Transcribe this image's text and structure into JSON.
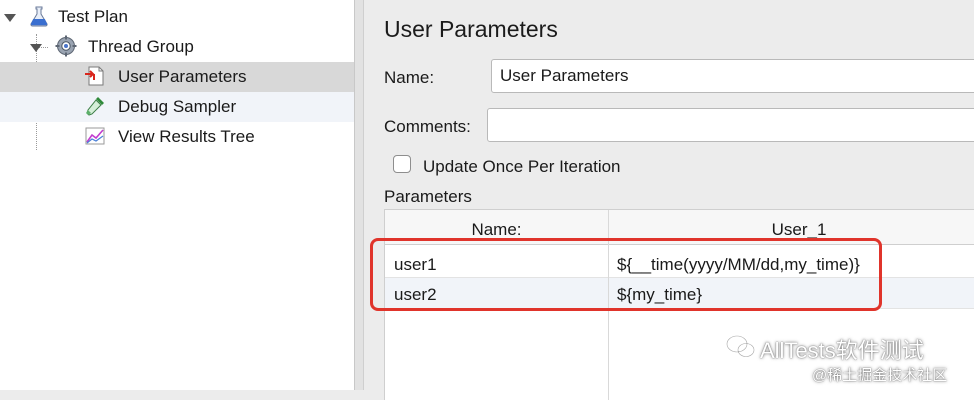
{
  "tree": {
    "items": [
      {
        "label": "Test Plan",
        "icon": "test-plan-flask-icon"
      },
      {
        "label": "Thread Group",
        "icon": "thread-group-gear-icon"
      },
      {
        "label": "User Parameters",
        "icon": "user-parameters-icon"
      },
      {
        "label": "Debug Sampler",
        "icon": "debug-sampler-pipette-icon"
      },
      {
        "label": "View Results Tree",
        "icon": "view-results-tree-icon"
      }
    ]
  },
  "panel": {
    "title": "User Parameters",
    "name_label": "Name:",
    "name_value": "User Parameters",
    "comments_label": "Comments:",
    "comments_value": "",
    "update_once_label": "Update Once Per Iteration",
    "update_once_checked": false,
    "parameters_label": "Parameters"
  },
  "table": {
    "columns": [
      "Name:",
      "User_1"
    ],
    "rows": [
      {
        "name": "user1",
        "value": "${__time(yyyy/MM/dd,my_time)}"
      },
      {
        "name": "user2",
        "value": "${my_time}"
      }
    ]
  },
  "watermark": {
    "brand": "AllTests软件测试",
    "site": "@稀土掘金技术社区"
  },
  "colors": {
    "highlight": "#e0342b",
    "selected_row": "#d8d8d8",
    "alt_row": "#f1f4f9"
  }
}
